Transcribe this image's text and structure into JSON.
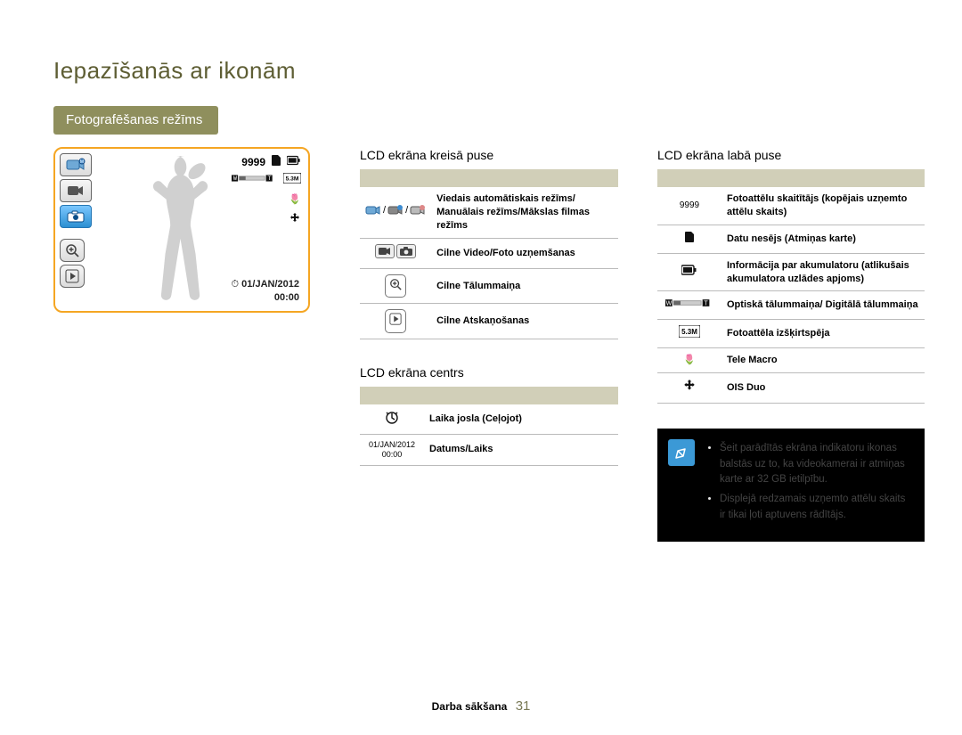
{
  "page_title": "Iepazīšanās ar ikonām",
  "mode_pill": "Fotografēšanas režīms",
  "footer": {
    "section": "Darba sākšana",
    "page": "31"
  },
  "preview": {
    "counter": "9999",
    "date": "01/JAN/2012",
    "time": "00:00"
  },
  "left": {
    "title": "LCD ekrāna kreisā puse",
    "rows": [
      {
        "icon": "modes-row",
        "label": "Viedais automātiskais režīms/ Manuālais režīms/Mākslas filmas režīms"
      },
      {
        "icon": "vidphoto",
        "label": "Cilne Video/Foto uzņemšanas"
      },
      {
        "icon": "zoom",
        "label": "Cilne Tālummaiņa"
      },
      {
        "icon": "play",
        "label": "Cilne Atskaņošanas"
      }
    ]
  },
  "center": {
    "title": "LCD ekrāna centrs",
    "rows": [
      {
        "icon": "timelapse",
        "label": "Laika josla (Ceļojot)"
      },
      {
        "icon": "datetime",
        "aux": "01/JAN/2012 00:00",
        "label": "Datums/Laiks"
      }
    ]
  },
  "right": {
    "title": "LCD ekrāna labā puse",
    "rows": [
      {
        "icon": "count9999",
        "aux": "9999",
        "label": "Fotoattēlu skaitītājs (kopējais uzņemto attēlu skaits)"
      },
      {
        "icon": "sdcard",
        "label": "Datu nesējs (Atmiņas karte)"
      },
      {
        "icon": "battery",
        "label": "Informācija par akumulatoru (atlikušais akumulatora uzlādes apjoms)"
      },
      {
        "icon": "zoombar",
        "label": "Optiskā tālummaiņa/ Digitālā tālummaiņa"
      },
      {
        "icon": "res53m",
        "label": "Fotoattēla izšķirtspēja"
      },
      {
        "icon": "telemacro",
        "label": "Tele Macro"
      },
      {
        "icon": "oisduo",
        "label": "OIS Duo"
      }
    ]
  },
  "note": {
    "items": [
      "Šeit parādītās ekrāna indikatoru ikonas balstās uz to, ka videokamerai ir atmiņas karte ar 32 GB ietilpību.",
      "Displejā redzamais uzņemto attēlu skaits ir tikai ļoti aptuvens rādītājs."
    ]
  }
}
